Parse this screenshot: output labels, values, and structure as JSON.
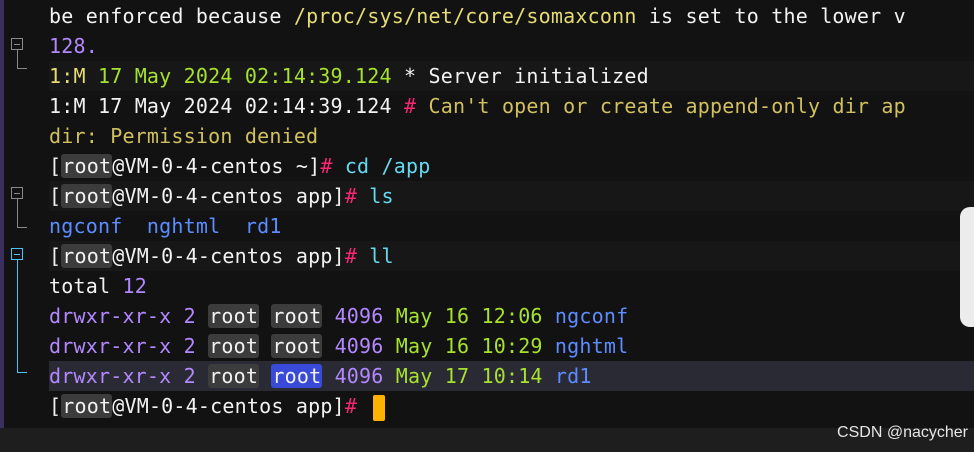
{
  "terminal": {
    "lines": [
      {
        "parts": [
          {
            "t": "be enforced because ",
            "c": "tok-white"
          },
          {
            "t": "/proc/sys/net/core/somaxconn",
            "c": "tok-yellow"
          },
          {
            "t": " is set to the lower v",
            "c": "tok-white"
          }
        ]
      },
      {
        "parts": [
          {
            "t": "128.",
            "c": "tok-purple"
          }
        ]
      },
      {
        "parts": [
          {
            "t": "1:M ",
            "c": "tok-yellow"
          },
          {
            "t": "17 May 2024",
            "c": "tok-green"
          },
          {
            "t": " 02:14:39.124",
            "c": "tok-green"
          },
          {
            "t": " * ",
            "c": "tok-white"
          },
          {
            "t": "Server initialized",
            "c": "tok-white"
          }
        ]
      },
      {
        "parts": [
          {
            "t": "1:M ",
            "c": "tok-white"
          },
          {
            "t": "17 May 2024 02:14:39.124",
            "c": "tok-white"
          },
          {
            "t": " # ",
            "c": "tok-red"
          },
          {
            "t": "Can't open or create append-only dir ap",
            "c": "tok-olive"
          }
        ]
      },
      {
        "parts": [
          {
            "t": "dir: Permission denied",
            "c": "tok-olive"
          }
        ]
      },
      {
        "parts": [
          {
            "t": "[",
            "c": "tok-white"
          },
          {
            "t": "root",
            "c": "tok-white box"
          },
          {
            "t": "@VM-0-4-centos ~]",
            "c": "tok-white"
          },
          {
            "t": "# ",
            "c": "tok-red"
          },
          {
            "t": "cd /app",
            "c": "tok-cyan"
          }
        ]
      },
      {
        "parts": [
          {
            "t": "[",
            "c": "tok-white"
          },
          {
            "t": "root",
            "c": "tok-white box"
          },
          {
            "t": "@VM-0-4-centos app]",
            "c": "tok-white"
          },
          {
            "t": "# ",
            "c": "tok-red"
          },
          {
            "t": "ls",
            "c": "tok-cyan"
          }
        ]
      },
      {
        "parts": [
          {
            "t": "ngconf  nghtml  rd1",
            "c": "tok-blue"
          }
        ]
      },
      {
        "parts": [
          {
            "t": "[",
            "c": "tok-white"
          },
          {
            "t": "root",
            "c": "tok-white box"
          },
          {
            "t": "@VM-0-4-centos app]",
            "c": "tok-white"
          },
          {
            "t": "# ",
            "c": "tok-red"
          },
          {
            "t": "ll",
            "c": "tok-cyan"
          }
        ]
      },
      {
        "parts": [
          {
            "t": "total ",
            "c": "tok-white"
          },
          {
            "t": "12",
            "c": "tok-purple"
          }
        ]
      },
      {
        "parts": [
          {
            "t": "drwxr-xr-x ",
            "c": "tok-purple"
          },
          {
            "t": "2 ",
            "c": "tok-purple"
          },
          {
            "t": "root",
            "c": "tok-white box"
          },
          {
            "t": " ",
            "c": "tok-white"
          },
          {
            "t": "root",
            "c": "tok-white box"
          },
          {
            "t": " 4096 ",
            "c": "tok-purple"
          },
          {
            "t": "May 16 12:06 ",
            "c": "tok-green"
          },
          {
            "t": "ngconf",
            "c": "tok-blue"
          }
        ]
      },
      {
        "parts": [
          {
            "t": "drwxr-xr-x ",
            "c": "tok-purple"
          },
          {
            "t": "2 ",
            "c": "tok-purple"
          },
          {
            "t": "root",
            "c": "tok-white box"
          },
          {
            "t": " ",
            "c": "tok-white"
          },
          {
            "t": "root",
            "c": "tok-white box"
          },
          {
            "t": " 4096 ",
            "c": "tok-purple"
          },
          {
            "t": "May 16 10:29 ",
            "c": "tok-green"
          },
          {
            "t": "nghtml",
            "c": "tok-blue"
          }
        ]
      },
      {
        "parts": [
          {
            "t": "drwxr-xr-x ",
            "c": "tok-purple"
          },
          {
            "t": "2 ",
            "c": "tok-purple"
          },
          {
            "t": "root",
            "c": "tok-white box"
          },
          {
            "t": " ",
            "c": "tok-white"
          },
          {
            "t": "root",
            "c": "box-blue"
          },
          {
            "t": " 4096 ",
            "c": "tok-purple"
          },
          {
            "t": "May 17 10:14 ",
            "c": "tok-green"
          },
          {
            "t": "rd1",
            "c": "tok-blue"
          }
        ]
      },
      {
        "parts": [
          {
            "t": "[",
            "c": "tok-white"
          },
          {
            "t": "root",
            "c": "tok-white box"
          },
          {
            "t": "@VM-0-4-centos app]",
            "c": "tok-white"
          },
          {
            "t": "# ",
            "c": "tok-red"
          }
        ],
        "cursor": true
      }
    ]
  },
  "watermark": "CSDN @nacycher",
  "colors": {
    "background": "#121212",
    "cursor": "#ffb300",
    "accent": "#4fc3f7"
  }
}
